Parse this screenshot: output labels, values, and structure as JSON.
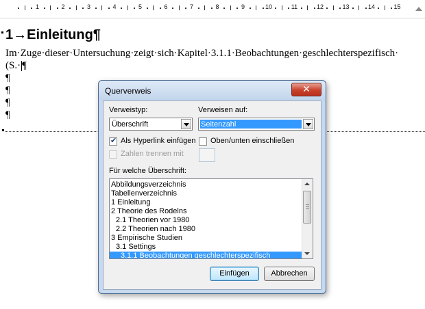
{
  "ruler": {
    "numbers": [
      "1",
      "2",
      "3",
      "4",
      "5",
      "6",
      "7",
      "8",
      "9",
      "10",
      "11",
      "12",
      "13",
      "14",
      "15"
    ]
  },
  "document": {
    "heading_number": "1",
    "heading_arrow": "→",
    "heading_text": "Einleitung",
    "pilcrow": "¶",
    "body_line_1": "Im·Zuge·dieser·Untersuchung·zeigt·sich·Kapitel·3.1.1·Beobachtungen·geschlechterspezifisch·",
    "body_line_2": "(S.·"
  },
  "dialog": {
    "title": "Querverweis",
    "close_symbol": "✕",
    "verweistyp_label": "Verweistyp:",
    "verweistyp_value": "Überschrift",
    "verweisen_auf_label": "Verweisen auf:",
    "verweisen_auf_value": "Seitenzahl",
    "hyperlink_label": "Als Hyperlink einfügen",
    "hyperlink_checked": true,
    "oben_unten_label": "Oben/unten einschließen",
    "oben_unten_checked": false,
    "zahlen_trennen_label": "Zahlen trennen mit",
    "fuer_welche_label": "Für welche Überschrift:",
    "headings_list": [
      {
        "label": "Abbildungsverzeichnis",
        "selected": false
      },
      {
        "label": "Tabellenverzeichnis",
        "selected": false
      },
      {
        "label": "1 Einleitung",
        "selected": false
      },
      {
        "label": "2 Theorie des Rodelns",
        "selected": false
      },
      {
        "label": "2.1 Theorien vor 1980",
        "selected": false
      },
      {
        "label": "2.2 Theorien nach 1980",
        "selected": false
      },
      {
        "label": "3 Empirische Studien",
        "selected": false
      },
      {
        "label": "3.1 Settings",
        "selected": false
      },
      {
        "label": "3.1.1 Beobachtungen geschlechterspezifisch",
        "selected": true
      }
    ],
    "insert_button": "Einfügen",
    "cancel_button": "Abbrechen"
  },
  "colors": {
    "selection": "#3399ff",
    "dialog_frame": "#c6d9ee",
    "close_button": "#c8412b"
  }
}
